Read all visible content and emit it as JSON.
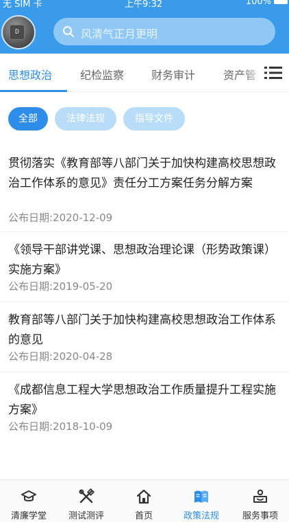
{
  "status_bar": {
    "carrier": "无 SIM 卡",
    "time": "上午9:32",
    "battery": "100%"
  },
  "header": {
    "search_placeholder": "风清气正月更明"
  },
  "tabs": [
    {
      "label": "思想政治"
    },
    {
      "label": "纪检监察"
    },
    {
      "label": "财务审计"
    },
    {
      "label": "资产管"
    }
  ],
  "filters": [
    {
      "label": "全部"
    },
    {
      "label": "法律法规"
    },
    {
      "label": "指导文件"
    }
  ],
  "articles": [
    {
      "title": "贯彻落实《教育部等八部门关于加快构建高校思想政治工作体系的意见》责任分工方案任务分解方案",
      "date": "公布日期:2020-12-09"
    },
    {
      "title": "《领导干部讲党课、思想政治理论课（形势政策课）实施方案》",
      "date": "公布日期:2019-05-20"
    },
    {
      "title": "教育部等八部门关于加快构建高校思想政治工作体系的意见",
      "date": "公布日期:2020-04-28"
    },
    {
      "title": "《成都信息工程大学思想政治工作质量提升工程实施方案》",
      "date": "公布日期:2018-10-09"
    }
  ],
  "tabbar": [
    {
      "label": "清廉学堂",
      "icon": "graduation-cap-icon"
    },
    {
      "label": "测试测评",
      "icon": "tools-icon"
    },
    {
      "label": "首页",
      "icon": "home-icon"
    },
    {
      "label": "政策法规",
      "icon": "book-icon"
    },
    {
      "label": "服务事项",
      "icon": "service-icon"
    }
  ],
  "colors": {
    "primary": "#3a9bea",
    "accent": "#2d8de8",
    "chip_inactive": "#b9dcf8"
  }
}
